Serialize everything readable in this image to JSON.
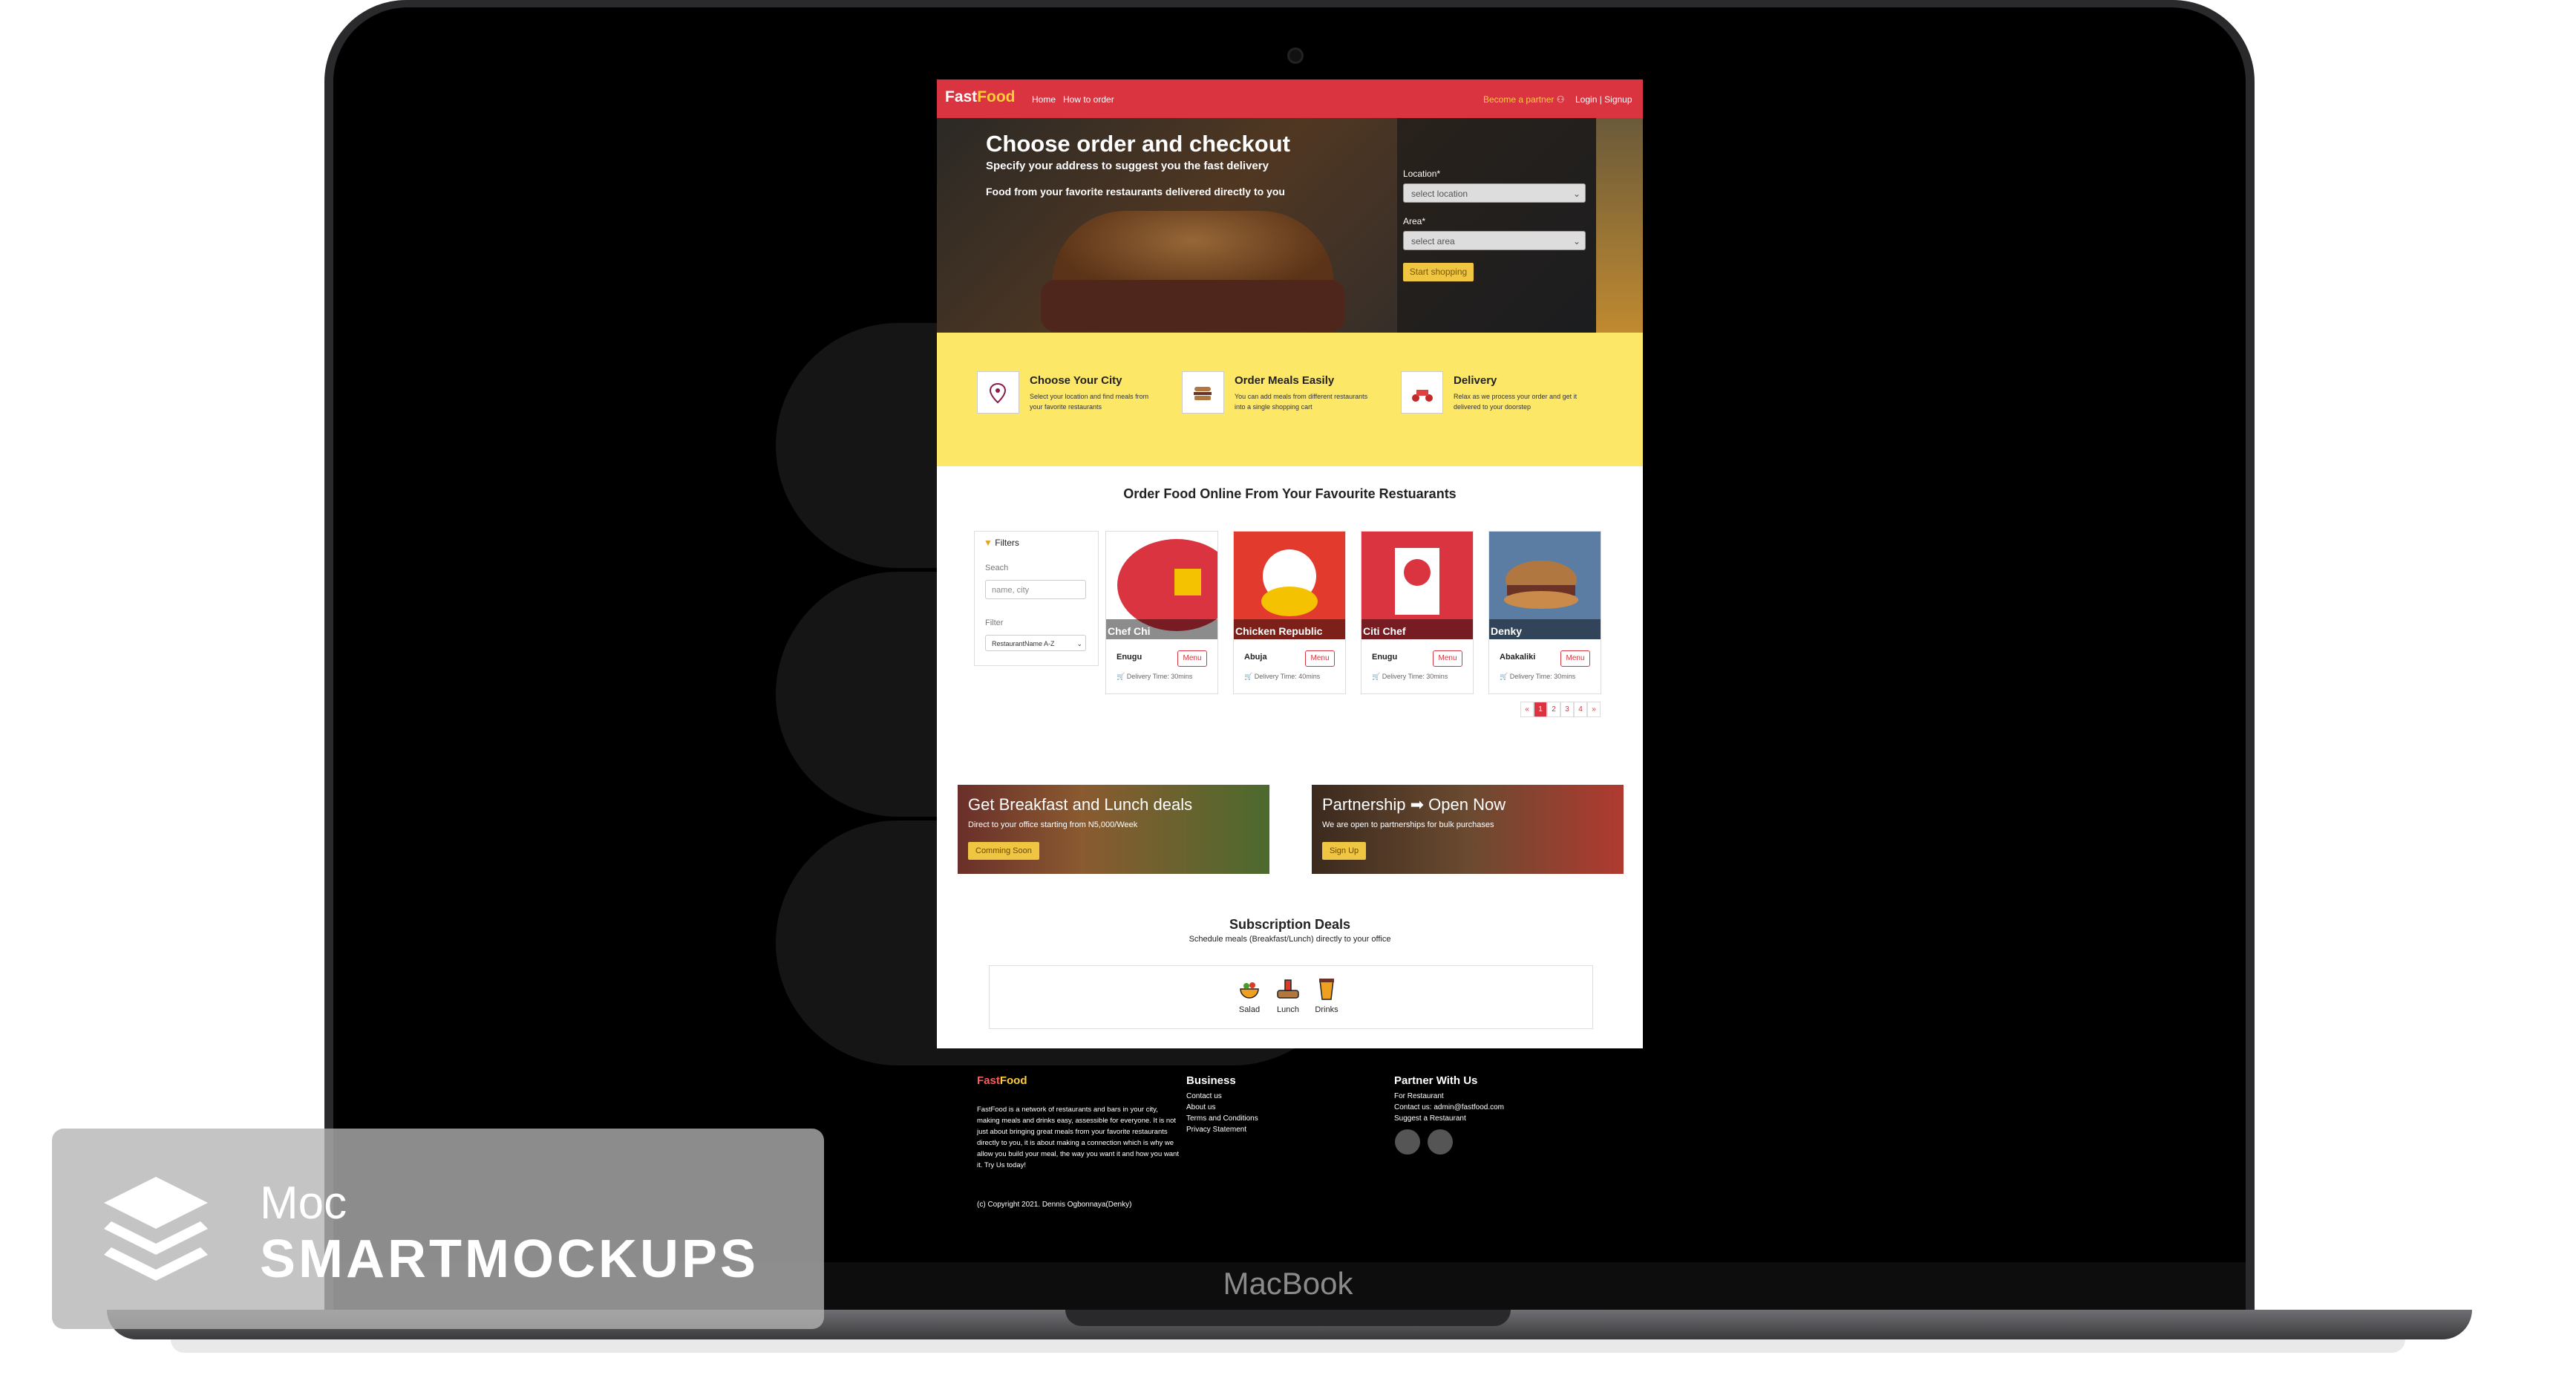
{
  "device": {
    "brand": "MacBook"
  },
  "watermark": {
    "line1": "Moc",
    "line2": "SMARTMOCKUPS"
  },
  "nav": {
    "logo_part1": "Fast",
    "logo_part2": "Food",
    "links": [
      "Home",
      "How to order"
    ],
    "partner": "Become a partner",
    "auth": "Login | Signup"
  },
  "hero": {
    "title": "Choose order and checkout",
    "subtitle": "Specify your address to suggest you the fast delivery",
    "tagline": "Food from your favorite restaurants delivered directly to you",
    "location_label": "Location*",
    "location_value": "select location",
    "area_label": "Area*",
    "area_value": "select area",
    "button": "Start shopping"
  },
  "features": [
    {
      "title": "Choose Your City",
      "desc": "Select your location and find meals from your favorite restaurants",
      "icon": "map-pin-icon"
    },
    {
      "title": "Order Meals Easily",
      "desc": "You can add meals from different restaurants into a single shopping cart",
      "icon": "burger-icon"
    },
    {
      "title": "Delivery",
      "desc": "Relax as we process your order and get it delivered to your doorstep",
      "icon": "scooter-icon"
    }
  ],
  "restaurants_section": {
    "title": "Order Food Online From Your Favourite Restuarants",
    "filters": {
      "heading": "Filters",
      "search_label": "Seach",
      "search_placeholder": "name, city",
      "filter_label": "Filter",
      "filter_value": "RestaurantName A-Z"
    },
    "cards": [
      {
        "name": "Chef Chi",
        "city": "Enugu",
        "menu": "Menu",
        "delivery": "Delivery Time: 30mins",
        "color": "#d9343f"
      },
      {
        "name": "Chicken Republic",
        "city": "Abuja",
        "menu": "Menu",
        "delivery": "Delivery Time: 40mins",
        "color": "#e23b2e"
      },
      {
        "name": "Citi Chef",
        "city": "Enugu",
        "menu": "Menu",
        "delivery": "Delivery Time: 30mins",
        "color": "#d9343f"
      },
      {
        "name": "Denky",
        "city": "Abakaliki",
        "menu": "Menu",
        "delivery": "Delivery Time: 30mins",
        "color": "#5c7da3"
      }
    ],
    "pagination": [
      "«",
      "1",
      "2",
      "3",
      "4",
      "»"
    ]
  },
  "banners": [
    {
      "title": "Get Breakfast and Lunch deals",
      "sub": "Direct to your office starting from N5,000/Week",
      "button": "Comming Soon"
    },
    {
      "title": "Partnership ➡ Open Now",
      "sub": "We are open to partnerships for bulk purchases",
      "button": "Sign Up"
    }
  ],
  "subscription": {
    "title": "Subscription Deals",
    "sub": "Schedule meals (Breakfast/Lunch) directly to your office",
    "items": [
      "Salad",
      "Lunch",
      "Drinks"
    ]
  },
  "footer": {
    "logo_part1": "Fast",
    "logo_part2": "Food",
    "about": "FastFood is a network of restaurants and bars in your city, making meals and drinks easy, assessible for everyone. It is not just about bringing great meals from your favorite restaurants directly to you, it is about making a connection which is why we allow you build your meal, the way you want it and how you want it. Try Us today!",
    "business_heading": "Business",
    "business_links": [
      "Contact us",
      "About us",
      "Terms and Conditions",
      "Privacy Statement"
    ],
    "partner_heading": "Partner With Us",
    "partner_links": [
      "For Restaurant",
      "Contact us: admin@fastfood.com",
      "Suggest a Restaurant"
    ],
    "copyright": "(c) Copyright 2021. Dennis Ogbonnaya(Denky)"
  }
}
